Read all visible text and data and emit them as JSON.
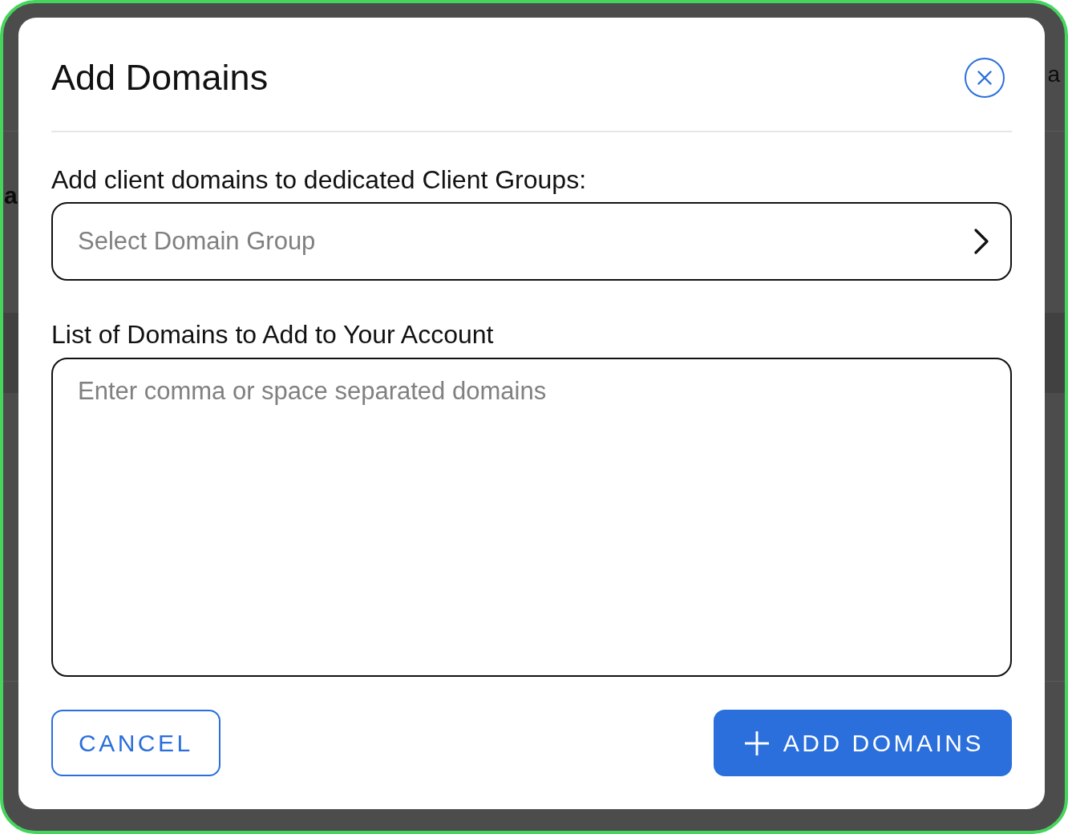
{
  "background": {
    "header_text": "a",
    "row_text": "a"
  },
  "dialog": {
    "title": "Add Domains"
  },
  "fields": [
    {
      "kind": "select",
      "label": "Add client domains to dedicated Client Groups:",
      "placeholder": "Select Domain Group"
    },
    {
      "kind": "textarea",
      "label": "List of Domains to Add to Your Account",
      "placeholder": "Enter comma or space separated domains"
    }
  ],
  "buttons": [
    {
      "kind": "outline",
      "label": "CANCEL"
    },
    {
      "kind": "primary",
      "label": "ADD DOMAINS"
    }
  ]
}
